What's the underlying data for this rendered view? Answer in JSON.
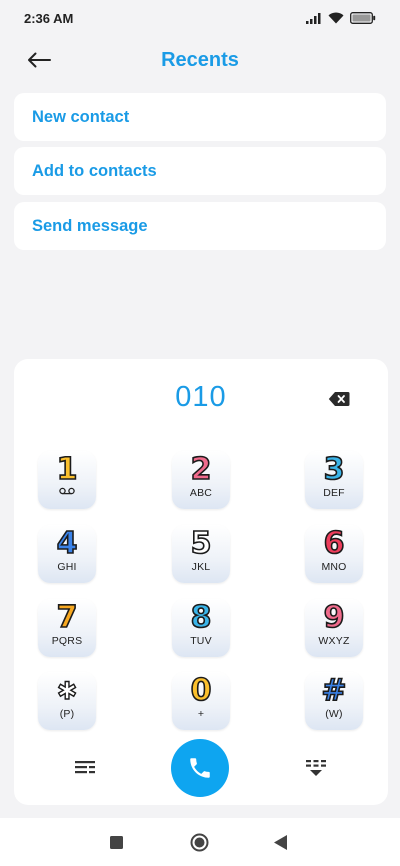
{
  "status": {
    "time": "2:36 AM"
  },
  "header": {
    "title": "Recents"
  },
  "actions": [
    {
      "label": "New contact"
    },
    {
      "label": "Add to contacts"
    },
    {
      "label": "Send message"
    }
  ],
  "dialer": {
    "number": "010",
    "keys": [
      {
        "digit": "1",
        "letters": "",
        "color": "#fbc02d"
      },
      {
        "digit": "2",
        "letters": "ABC",
        "color": "#f06b8c"
      },
      {
        "digit": "3",
        "letters": "DEF",
        "color": "#3ab4e8"
      },
      {
        "digit": "4",
        "letters": "GHI",
        "color": "#3a82e8"
      },
      {
        "digit": "5",
        "letters": "JKL",
        "color": "#ffffff"
      },
      {
        "digit": "6",
        "letters": "MNO",
        "color": "#ee3d5c"
      },
      {
        "digit": "7",
        "letters": "PQRS",
        "color": "#f7a820"
      },
      {
        "digit": "8",
        "letters": "TUV",
        "color": "#3ab4e8"
      },
      {
        "digit": "9",
        "letters": "WXYZ",
        "color": "#f06b8c"
      },
      {
        "digit": "✱",
        "letters": "(P)",
        "color": "#ffffff"
      },
      {
        "digit": "0",
        "letters": "+",
        "color": "#fbc02d"
      },
      {
        "digit": "#",
        "letters": "(W)",
        "color": "#3a82e8"
      }
    ]
  },
  "colors": {
    "accent": "#1a9be6",
    "call": "#0ea5f0"
  }
}
